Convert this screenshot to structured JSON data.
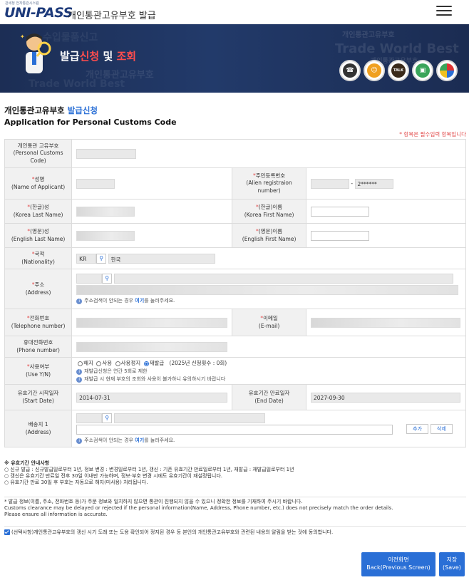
{
  "header": {
    "logo_small": "관세청 전자통관시스템",
    "logo_main": "UNI-PASS",
    "title": "개인통관고유부호  발급"
  },
  "banner": {
    "title_part1": "발급",
    "title_part2": "신청",
    "title_part3": " 및 ",
    "title_part4": "조회",
    "ghost1": "수입물품신고",
    "ghost2": "개인통관고유부호",
    "ghost3": "Trade World Best",
    "ghost4": "개인통관고유부호",
    "ghost5": "Trade World Best",
    "ghost6": "개인통관고유부호",
    "icon_talk": "TALK"
  },
  "heading": {
    "ko_part1": "개인통관고유부호 ",
    "ko_part2": "발급신청",
    "en": "Application for Personal Customs Code",
    "required_note": "* 항목은 필수입력 항목입니다"
  },
  "form": {
    "pcc_label": "개인통관 고유부호\n(Personal Customs Code)",
    "name_label_ko": "성명",
    "name_label_en": "(Name of Applicant)",
    "alien_label_ko": "주민등록번호",
    "alien_label_en": "(Alien registraion number)",
    "alien_dash": "-",
    "alien_suffix": "2******",
    "kor_last_ko": "(한글)성",
    "kor_last_en": "(Korea Last Name)",
    "kor_first_ko": "(한글)이름",
    "kor_first_en": "(Korea First Name)",
    "eng_last_ko": "(영문)성",
    "eng_last_en": "(English Last Name)",
    "eng_first_ko": "(영문)이름",
    "eng_first_en": "(English First Name)",
    "nation_ko": "국적",
    "nation_en": "(Nationality)",
    "nation_code": "KR",
    "nation_name": "한국",
    "addr_ko": "주소",
    "addr_en": "(Address)",
    "addr_hint_1": "주소검색이 안되는 경우 ",
    "addr_hint_link": "여기",
    "addr_hint_2": "를 눌러주세요.",
    "tel_ko": "전화번호",
    "tel_en": "(Telephone number)",
    "email_ko": "이메일",
    "email_en": "(E-mail)",
    "phone_ko": "휴대전화번호",
    "phone_en": "(Phone number)",
    "use_ko": "사용여부",
    "use_en": "(Use Y/N)",
    "use_opt1": "해지",
    "use_opt2": "사용",
    "use_opt3": "사용정지",
    "use_opt4": "재발급",
    "use_count": "(2025년 신청횟수 : 0회)",
    "use_hint1": "재발급신청은 연간 5회로 제한",
    "use_hint2": "재발급 시 현재 부호의 조회와 사용이 불가하니 유의하시기 바랍니다",
    "start_ko": "유효기간 시작일자",
    "start_en": "(Start Date)",
    "start_val": "2014-07-31",
    "end_ko": "유효기간 만료일자",
    "end_en": "(End Date)",
    "end_val": "2027-09-30",
    "ship_ko": "배송지 1",
    "ship_en": "(Address)",
    "ship_add": "추가",
    "ship_delete": "삭제"
  },
  "notice": {
    "title": "※ 유효기간 안내사항",
    "line1": "○ 신규 발급 : 신규발급일로부터 1년, 정보 변경 : 변경일로부터 1년, 갱신 : 기존 유효기간 만료일로부터 1년, 재발급 : 재발급일로부터 1년",
    "line2": "○ 갱신은 유효기간 만료일 전후 30일 이내만 가능하며, 정보·부호 변경 시에도 유효기간이 재설정됩니다.",
    "line3": "○ 유효기간 만료 30일 후 부호는 자동으로 해지(미사용) 처리됩니다.",
    "warn1": "* 발급 정보(이름, 주소, 전화번호 등)가 주문 정보와 일치하지 않으면 통관이 진행되지 않을 수 있으니 정확한 정보를 기재하여 주시기 바랍니다.",
    "warn2": "Customs clearance may be delayed or rejected if the personal information(Name, Address, Phone number, etc.) does not precisely match the order details.",
    "warn3": "Please ensure all information is accurate.",
    "consent": "(선택사항)개인통관고유부호의 갱신 시기 도래 또는 도용 확인되어 정지된 경우 등 본인의 개인통관고유부호와 관련된 내용의 알림을 받는 것에 동의합니다."
  },
  "buttons": {
    "back_ko": "이전화면",
    "back_en": "Back(Previous Screen)",
    "save_ko": "저장",
    "save_en": "(Save)"
  }
}
